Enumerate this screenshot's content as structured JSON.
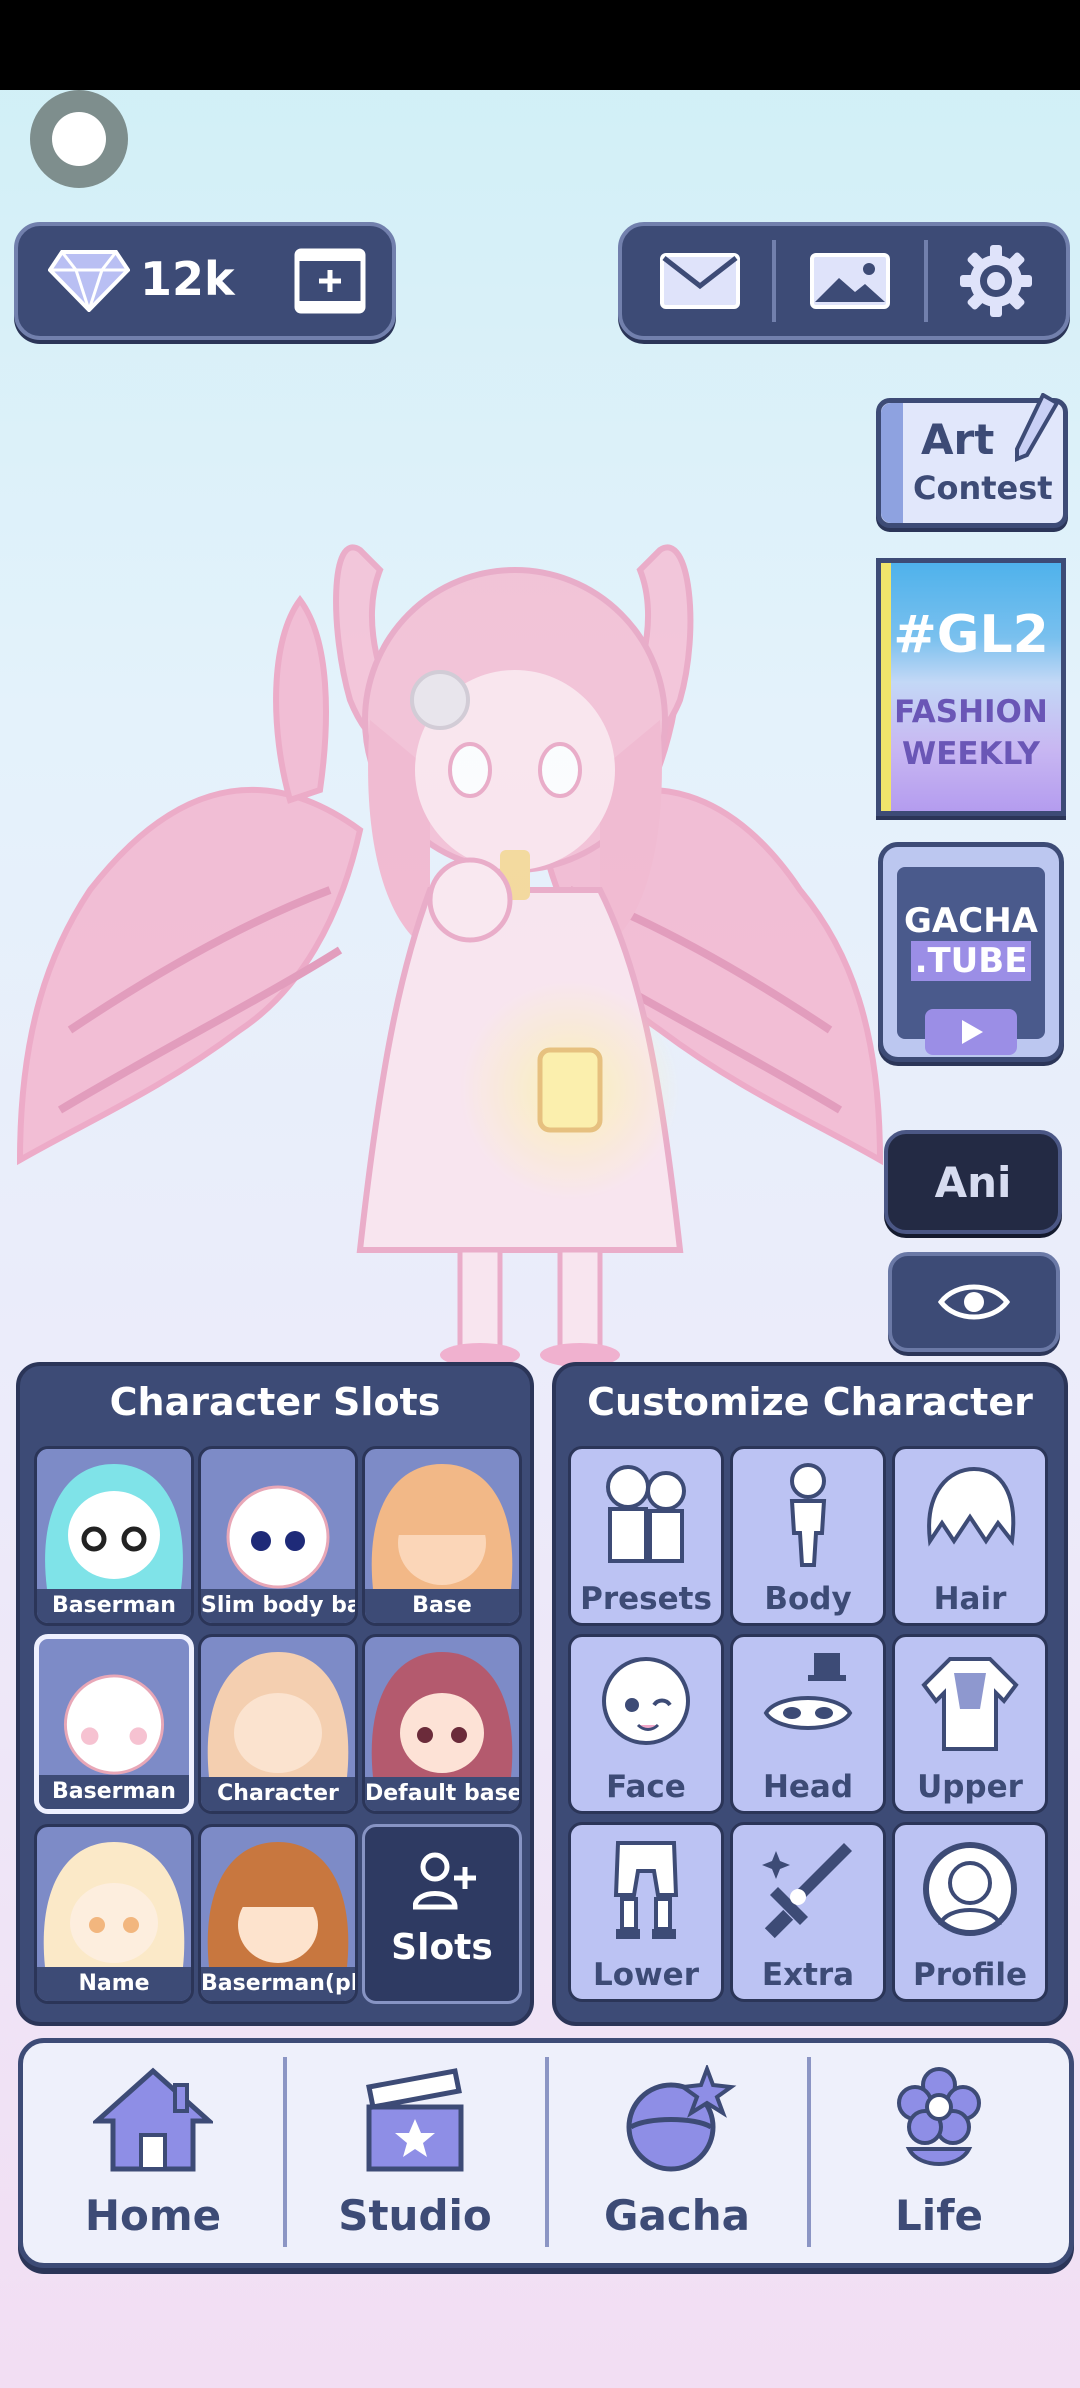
{
  "currency": {
    "gems": "12k"
  },
  "side": {
    "art_line1": "Art",
    "art_line2": "Contest",
    "gl2_line1": "#GL2",
    "gl2_line2": "FASHION",
    "gl2_line3": "WEEKLY",
    "tube_line1": "GACHA",
    "tube_line2": ".TUBE",
    "ani_label": "Ani"
  },
  "slots": {
    "title": "Character Slots",
    "items": [
      {
        "label": "Baserman"
      },
      {
        "label": "Slim body bas"
      },
      {
        "label": "Base"
      },
      {
        "label": "Baserman"
      },
      {
        "label": "Character"
      },
      {
        "label": "Default base"
      },
      {
        "label": "Name"
      },
      {
        "label": "Baserman(plu"
      }
    ],
    "add_label": "Slots"
  },
  "customize": {
    "title": "Customize Character",
    "items": [
      {
        "label": "Presets"
      },
      {
        "label": "Body"
      },
      {
        "label": "Hair"
      },
      {
        "label": "Face"
      },
      {
        "label": "Head"
      },
      {
        "label": "Upper"
      },
      {
        "label": "Lower"
      },
      {
        "label": "Extra"
      },
      {
        "label": "Profile"
      }
    ]
  },
  "nav": {
    "home": "Home",
    "studio": "Studio",
    "gacha": "Gacha",
    "life": "Life"
  },
  "colors": {
    "panel": "#3d4b76",
    "tile": "#bcc3f3",
    "accent_pink": "#f2a7c8"
  }
}
